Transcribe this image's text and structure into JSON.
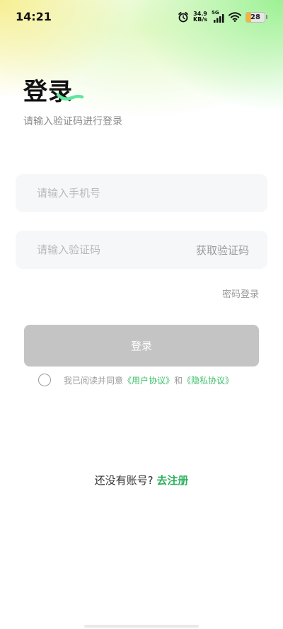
{
  "status_bar": {
    "time": "14:21",
    "net_speed_value": "34.9",
    "net_speed_unit": "KB/s",
    "signal_label": "5G",
    "battery_level": "28"
  },
  "login": {
    "title": "登录",
    "subtitle": "请输入验证码进行登录",
    "phone_placeholder": "请输入手机号",
    "code_placeholder": "请输入验证码",
    "get_code_label": "获取验证码",
    "password_login_label": "密码登录",
    "login_button_label": "登录"
  },
  "agreement": {
    "prefix": "我已阅读并同意",
    "user_agreement": "《用户协议》",
    "and": "和",
    "privacy_policy": "《隐私协议》"
  },
  "register": {
    "prompt": "还没有账号?",
    "link_label": "去注册"
  },
  "colors": {
    "accent": "#3cbf6a",
    "button_disabled": "#c4c4c4",
    "input_bg": "#f6f7f8"
  }
}
